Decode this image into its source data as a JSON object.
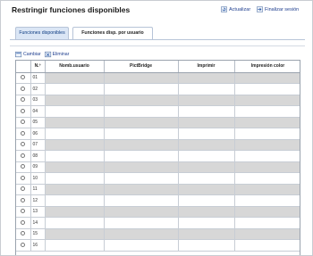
{
  "page": {
    "title": "Restringir funciones disponibles",
    "refresh_label": "Actualizar",
    "logout_label": "Finalizar sesión"
  },
  "tabs": [
    {
      "label": "Funciones disponibles",
      "active": true
    },
    {
      "label": "Funciones disp. por usuario",
      "active": false
    }
  ],
  "toolbar": {
    "change_label": "Cambiar",
    "delete_label": "Eliminar"
  },
  "table": {
    "columns": [
      "",
      "N.º",
      "Nomb.usuario",
      "PictBridge",
      "Imprimir",
      "Impresión color"
    ],
    "rows": [
      {
        "num": "01"
      },
      {
        "num": "02"
      },
      {
        "num": "03"
      },
      {
        "num": "04"
      },
      {
        "num": "05"
      },
      {
        "num": "06"
      },
      {
        "num": "07"
      },
      {
        "num": "08"
      },
      {
        "num": "09"
      },
      {
        "num": "10"
      },
      {
        "num": "11"
      },
      {
        "num": "12"
      },
      {
        "num": "13"
      },
      {
        "num": "14"
      },
      {
        "num": "15"
      },
      {
        "num": "16"
      }
    ]
  },
  "colors": {
    "accent": "#1f3f8f",
    "tab_active_bg": "#dbe6f5",
    "row_shade": "#d7d7d7"
  }
}
